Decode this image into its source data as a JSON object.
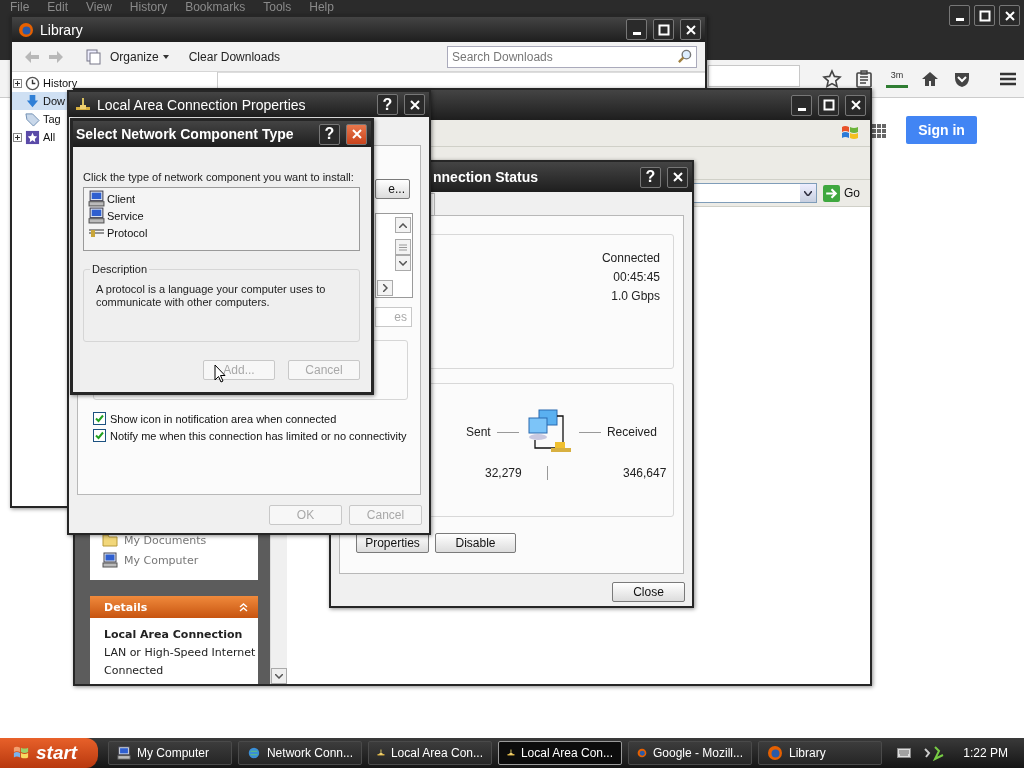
{
  "browser": {
    "menu": [
      "File",
      "Edit",
      "View",
      "History",
      "Bookmarks",
      "Tools",
      "Help"
    ],
    "badge": "3m",
    "sign_in": "Sign in"
  },
  "library": {
    "title": "Library",
    "organize": "Organize",
    "clear_downloads": "Clear Downloads",
    "search": {
      "placeholder": "Search Downloads"
    },
    "sidebar": [
      {
        "label": "History",
        "kind": "history",
        "expandable": true,
        "selected": false
      },
      {
        "label": "Dow",
        "kind": "downloads",
        "expandable": false,
        "selected": true
      },
      {
        "label": "Tag",
        "kind": "tags",
        "expandable": false,
        "selected": false
      },
      {
        "label": "All",
        "kind": "all",
        "expandable": true,
        "selected": false
      }
    ]
  },
  "network_connections": {
    "go": "Go",
    "tasks": [
      {
        "label": "My Documents",
        "kind": "documents"
      },
      {
        "label": "My Computer",
        "kind": "computer"
      }
    ],
    "details": {
      "header": "Details",
      "expanded": true,
      "name": "Local Area Connection",
      "type": "LAN or High-Speed Internet",
      "status": "Connected"
    }
  },
  "status_dialog": {
    "title": "nnection Status",
    "help": "?",
    "connection": [
      "Connected",
      "00:45:45",
      "1.0 Gbps"
    ],
    "sent_label": "Sent",
    "received_label": "Received",
    "sent": "32,279",
    "received": "346,647",
    "buttons": [
      {
        "label": "Properties"
      },
      {
        "label": "Disable"
      }
    ],
    "close": "Close"
  },
  "properties_dialog": {
    "title": "Local Area Connection Properties",
    "help": "?",
    "fragments": [
      "e...",
      "es"
    ],
    "checkboxes": [
      {
        "label": "Show icon in notification area when connected",
        "checked": true
      },
      {
        "label": "Notify me when this connection has limited or no connectivity",
        "checked": true
      }
    ],
    "buttons": [
      {
        "label": "OK",
        "disabled": true
      },
      {
        "label": "Cancel",
        "disabled": true
      }
    ]
  },
  "select_dialog": {
    "title": "Select Network Component Type",
    "help": "?",
    "prompt": "Click the type of network component you want to install:",
    "components": [
      {
        "label": "Client",
        "kind": "client",
        "selected": false
      },
      {
        "label": "Service",
        "kind": "service",
        "selected": false
      },
      {
        "label": "Protocol",
        "kind": "protocol",
        "selected": false
      }
    ],
    "description_label": "Description",
    "description": "A protocol is a language your computer uses to communicate with other computers.",
    "buttons": [
      {
        "label": "Add...",
        "disabled": true
      },
      {
        "label": "Cancel",
        "disabled": true
      }
    ]
  },
  "taskbar": {
    "start": "start",
    "items": [
      {
        "label": "My Computer",
        "kind": "computer",
        "selected": false
      },
      {
        "label": "Network Conn...",
        "kind": "network",
        "selected": false
      },
      {
        "label": "Local Area Con...",
        "kind": "lan",
        "selected": false
      },
      {
        "label": "Local Area Con...",
        "kind": "lan",
        "selected": true
      },
      {
        "label": "Google - Mozill...",
        "kind": "firefox",
        "selected": false
      },
      {
        "label": "Library",
        "kind": "firefox",
        "selected": false
      }
    ],
    "clock": "1:22 PM"
  }
}
